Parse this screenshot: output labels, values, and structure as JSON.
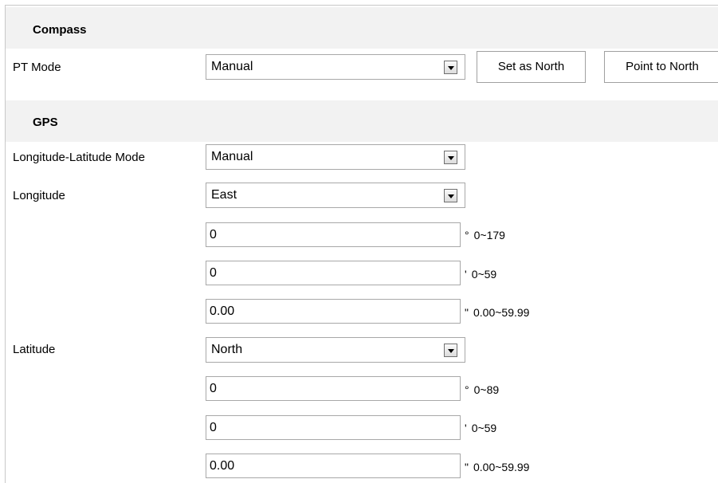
{
  "compass": {
    "title": "Compass",
    "pt_mode_label": "PT Mode",
    "pt_mode_value": "Manual",
    "set_as_north": "Set as North",
    "point_to_north": "Point to North"
  },
  "gps": {
    "title": "GPS",
    "mode_label": "Longitude-Latitude Mode",
    "mode_value": "Manual",
    "longitude_label": "Longitude",
    "longitude_dir": "East",
    "lon_degrees": "0",
    "lon_degrees_sym": "°",
    "lon_degrees_range": "0~179",
    "lon_minutes": "0",
    "lon_minutes_sym": "'",
    "lon_minutes_range": "0~59",
    "lon_seconds": "0.00",
    "lon_seconds_sym": "\"",
    "lon_seconds_range": "0.00~59.99",
    "latitude_label": "Latitude",
    "latitude_dir": "North",
    "lat_degrees": "0",
    "lat_degrees_sym": "°",
    "lat_degrees_range": "0~89",
    "lat_minutes": "0",
    "lat_minutes_sym": "'",
    "lat_minutes_range": "0~59",
    "lat_seconds": "0.00",
    "lat_seconds_sym": "\"",
    "lat_seconds_range": "0.00~59.99"
  }
}
